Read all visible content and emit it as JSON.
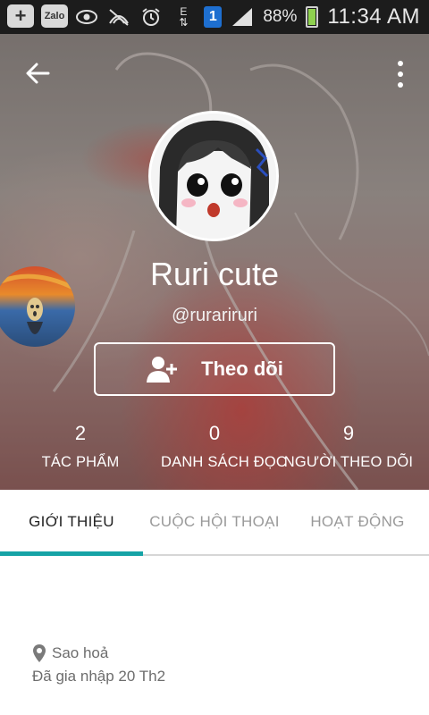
{
  "status_bar": {
    "icons": [
      "add-notification-icon",
      "zalo-icon",
      "eye-icon",
      "no-signal-icon",
      "alarm-icon",
      "data-e-icon",
      "sim-1-icon",
      "signal-icon",
      "battery-icon"
    ],
    "left_box_label": "Zalo",
    "data_label": "E",
    "sim_label": "1",
    "battery_percent": "88%",
    "battery_level": 0.88,
    "time": "11:34 AM"
  },
  "profile": {
    "name": "Ruri cute",
    "handle": "@rurariruri",
    "follow_button_label": "Theo dõi"
  },
  "stats": [
    {
      "value": "2",
      "label": "TÁC PHẨM"
    },
    {
      "value": "0",
      "label": "DANH SÁCH ĐỌC"
    },
    {
      "value": "9",
      "label": "NGƯỜI THEO DÕI"
    }
  ],
  "tabs": [
    {
      "label": "GIỚI THIỆU",
      "active": true
    },
    {
      "label": "CUỘC HỘI THOẠI",
      "active": false
    },
    {
      "label": "HOẠT ĐỘNG",
      "active": false
    }
  ],
  "about": {
    "location": "Sao hoả",
    "joined": "Đã gia nhập 20 Th2"
  },
  "colors": {
    "status_bar_bg": "#1c1c1c",
    "tab_indicator": "#16a3a6",
    "sim_badge": "#1e6fd0",
    "battery_fill": "#8fd14f"
  }
}
